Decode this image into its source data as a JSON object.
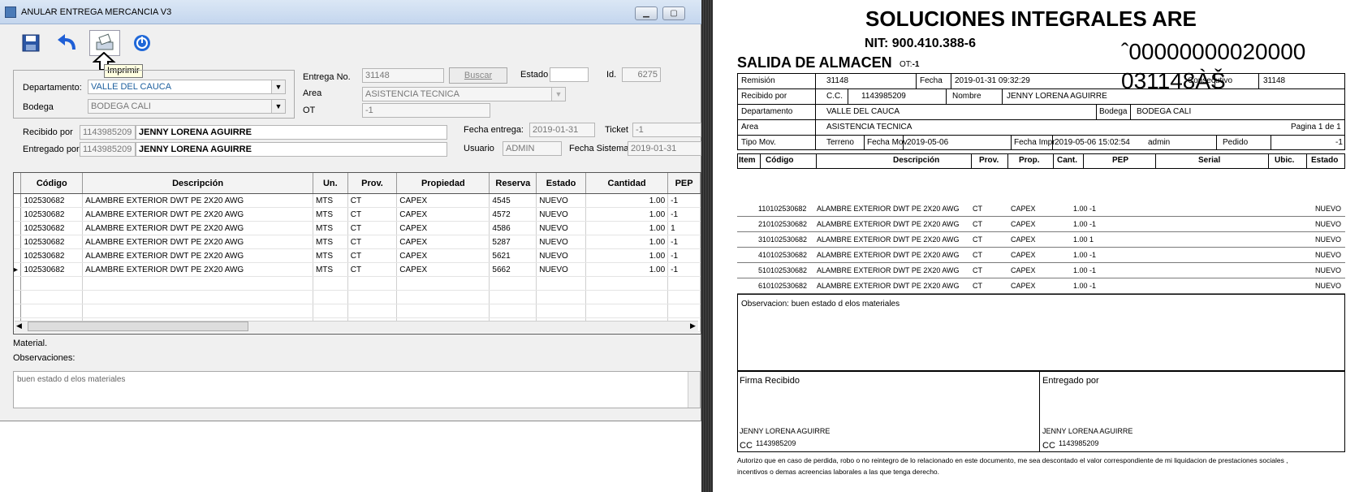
{
  "window": {
    "title": "ANULAR ENTREGA MERCANCIA V3",
    "tooltip": "Imprimir",
    "form": {
      "entrega_label": "Entrega No.",
      "entrega_value": "31148",
      "buscar_label": "Buscar",
      "estado_label": "Estado",
      "estado_value": "",
      "id_label": "Id.",
      "id_value": "6275",
      "departamento_label": "Departamento:",
      "departamento_value": "VALLE DEL CAUCA",
      "bodega_label": "Bodega",
      "bodega_value": "BODEGA CALI",
      "area_label": "Area",
      "area_value": "ASISTENCIA TECNICA",
      "ot_label": "OT",
      "ot_value": "-1",
      "recibido_label": "Recibido por",
      "recibido_id": "1143985209",
      "recibido_name": "JENNY LORENA AGUIRRE",
      "entregado_label": "Entregado por",
      "entregado_id": "1143985209",
      "entregado_name": "JENNY LORENA AGUIRRE",
      "fecha_entrega_label": "Fecha entrega:",
      "fecha_entrega_value": "2019-01-31",
      "ticket_label": "Ticket",
      "ticket_value": "-1",
      "usuario_label": "Usuario",
      "usuario_value": "ADMIN",
      "fecha_sistema_label": "Fecha Sistema",
      "fecha_sistema_value": "2019-01-31"
    },
    "grid": {
      "headers": [
        "Código",
        "Descripción",
        "Un.",
        "Prov.",
        "Propiedad",
        "Reserva",
        "Estado",
        "Cantidad",
        "PEP"
      ],
      "rows": [
        [
          "102530682",
          "ALAMBRE EXTERIOR DWT PE 2X20 AWG",
          "MTS",
          "CT",
          "CAPEX",
          "4545",
          "NUEVO",
          "1.00",
          "-1"
        ],
        [
          "102530682",
          "ALAMBRE EXTERIOR DWT PE 2X20 AWG",
          "MTS",
          "CT",
          "CAPEX",
          "4572",
          "NUEVO",
          "1.00",
          "-1"
        ],
        [
          "102530682",
          "ALAMBRE EXTERIOR DWT PE 2X20 AWG",
          "MTS",
          "CT",
          "CAPEX",
          "4586",
          "NUEVO",
          "1.00",
          "1"
        ],
        [
          "102530682",
          "ALAMBRE EXTERIOR DWT PE 2X20 AWG",
          "MTS",
          "CT",
          "CAPEX",
          "5287",
          "NUEVO",
          "1.00",
          "-1"
        ],
        [
          "102530682",
          "ALAMBRE EXTERIOR DWT PE 2X20 AWG",
          "MTS",
          "CT",
          "CAPEX",
          "5621",
          "NUEVO",
          "1.00",
          "-1"
        ],
        [
          "102530682",
          "ALAMBRE EXTERIOR DWT PE 2X20 AWG",
          "MTS",
          "CT",
          "CAPEX",
          "5662",
          "NUEVO",
          "1.00",
          "-1"
        ]
      ]
    },
    "material_label": "Material.",
    "observaciones_label": "Observaciones:",
    "observaciones_value": "buen estado d elos materiales",
    "icons": [
      "save-icon",
      "undo-icon",
      "print-icon",
      "power-icon"
    ]
  },
  "report": {
    "company": "SOLUCIONES INTEGRALES ARE",
    "nit": "NIT: 900.410.388-6",
    "doc_title": "SALIDA DE ALMACEN",
    "ot_label": "OT:",
    "ot_value": "-1",
    "barcode_line1": "ˆ00000000020000",
    "barcode_line2": "031148ÀŠ",
    "remision_label": "Remisión",
    "remision_value": "31148",
    "fecha_label": "Fecha",
    "fecha_value": "2019-01-31 09:32:29",
    "consecutivo_label": "Consecutivo",
    "consecutivo_value": "31148",
    "recibido_label": "Recibido por",
    "cc_label": "C.C.",
    "cc_value": "1143985209",
    "nombre_label": "Nombre",
    "nombre_value": "JENNY LORENA AGUIRRE",
    "departamento_label": "Departamento",
    "departamento_value": "VALLE DEL CAUCA",
    "bodega_label": "Bodega",
    "bodega_value": "BODEGA CALI",
    "area_label": "Area",
    "area_value": "ASISTENCIA TECNICA",
    "pagina": "Pagina 1 de 1",
    "tipo_mov_label": "Tipo Mov.",
    "tipo_mov_value": "Terreno",
    "fecha_mov_label": "Fecha Mov.",
    "fecha_mov_value": "2019-05-06",
    "fecha_impr_label": "Fecha Impr",
    "fecha_impr_value": "2019-05-06 15:02:54",
    "user_value": "admin",
    "pedido_label": "Pedido",
    "pedido_value": "-1",
    "headers": [
      "Item",
      "Código",
      "Descripción",
      "Prov.",
      "Prop.",
      "Cant.",
      "PEP",
      "Serial",
      "Ubic.",
      "Estado"
    ],
    "rows": [
      {
        "item_code": "110102530682",
        "desc": "ALAMBRE EXTERIOR DWT PE 2X20 AWG",
        "prov": "CT",
        "prop": "CAPEX",
        "cant_pep": "1.00 -1",
        "estado": "NUEVO"
      },
      {
        "item_code": "210102530682",
        "desc": "ALAMBRE EXTERIOR DWT PE 2X20 AWG",
        "prov": "CT",
        "prop": "CAPEX",
        "cant_pep": "1.00 -1",
        "estado": "NUEVO"
      },
      {
        "item_code": "310102530682",
        "desc": "ALAMBRE EXTERIOR DWT PE 2X20 AWG",
        "prov": "CT",
        "prop": "CAPEX",
        "cant_pep": "1.00 1",
        "estado": "NUEVO"
      },
      {
        "item_code": "410102530682",
        "desc": "ALAMBRE EXTERIOR DWT PE 2X20 AWG",
        "prov": "CT",
        "prop": "CAPEX",
        "cant_pep": "1.00 -1",
        "estado": "NUEVO"
      },
      {
        "item_code": "510102530682",
        "desc": "ALAMBRE EXTERIOR DWT PE 2X20 AWG",
        "prov": "CT",
        "prop": "CAPEX",
        "cant_pep": "1.00 -1",
        "estado": "NUEVO"
      },
      {
        "item_code": "610102530682",
        "desc": "ALAMBRE EXTERIOR DWT PE 2X20 AWG",
        "prov": "CT",
        "prop": "CAPEX",
        "cant_pep": "1.00 -1",
        "estado": "NUEVO"
      }
    ],
    "observacion": "Observacion: buen estado d elos materiales",
    "firma_label": "Firma Recibido",
    "entregado_label": "Entregado por",
    "firma_name": "JENNY LORENA AGUIRRE",
    "firma_cc_label": "CC",
    "firma_cc_value": "1143985209",
    "entregado_name": "JENNY LORENA AGUIRRE",
    "entregado_cc_label": "CC",
    "entregado_cc_value": "1143985209",
    "disclaimer_line1": "Autorizo que en caso de perdida, robo o no reintegro de lo relacionado en este documento, me sea descontado el valor correspondiente de mi liquidacion de prestaciones sociales ,",
    "disclaimer_line2": "incentivos o demas acreencias laborales a las que tenga derecho."
  }
}
